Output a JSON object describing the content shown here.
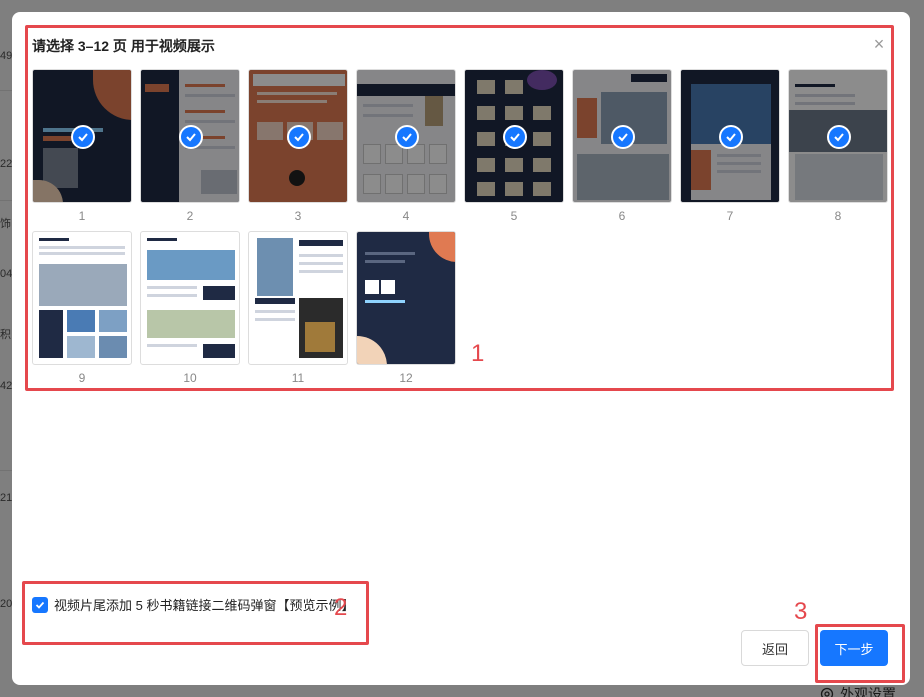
{
  "background": {
    "numbers": [
      "49",
      "22",
      "饰",
      "04",
      "积",
      "42",
      "21",
      "20"
    ],
    "footer_label": "外观设置"
  },
  "modal": {
    "title": "请选择 3–12 页 用于视频展示",
    "close_icon": "close-icon",
    "pages": [
      {
        "label": "1",
        "selected": true,
        "style": "dark"
      },
      {
        "label": "2",
        "selected": true,
        "style": "menu"
      },
      {
        "label": "3",
        "selected": true,
        "style": "orange"
      },
      {
        "label": "4",
        "selected": true,
        "style": "trophy"
      },
      {
        "label": "5",
        "selected": true,
        "style": "dark-grid"
      },
      {
        "label": "6",
        "selected": true,
        "style": "buildings"
      },
      {
        "label": "7",
        "selected": true,
        "style": "building-list"
      },
      {
        "label": "8",
        "selected": true,
        "style": "office"
      },
      {
        "label": "9",
        "selected": false,
        "style": "white-building"
      },
      {
        "label": "10",
        "selected": false,
        "style": "white-house"
      },
      {
        "label": "11",
        "selected": false,
        "style": "white-tower"
      },
      {
        "label": "12",
        "selected": false,
        "style": "dark-qr"
      }
    ],
    "tail_option": {
      "checked": true,
      "label": "视频片尾添加 5 秒书籍链接二维码弹窗【预览示例】"
    },
    "back_label": "返回",
    "next_label": "下一步"
  },
  "annotations": {
    "box1": "1",
    "box2": "2",
    "box3": "3"
  },
  "colors": {
    "accent": "#1677ff",
    "annotation": "#e5484d"
  }
}
